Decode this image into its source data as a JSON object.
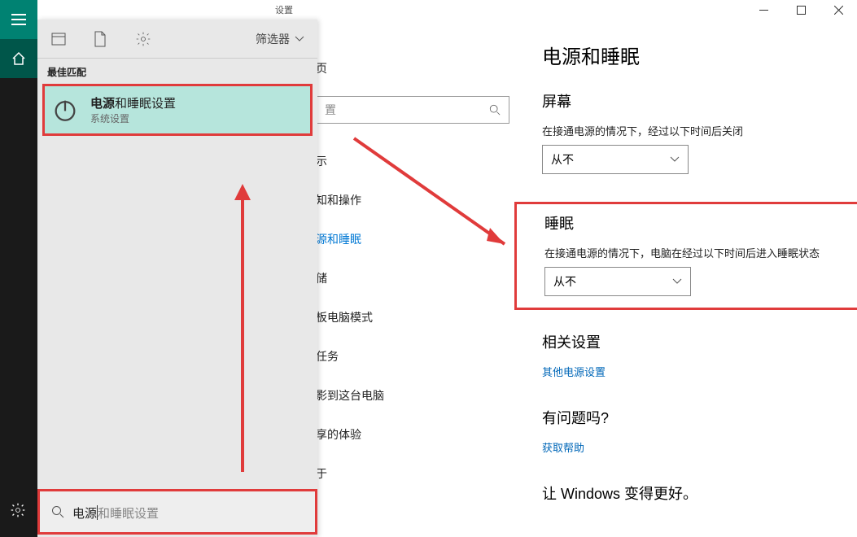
{
  "window": {
    "title": "设置"
  },
  "overlay": {
    "filter_label": "筛选器",
    "best_match": "最佳匹配",
    "result": {
      "prefix_bold": "电源",
      "rest": "和睡眠设置",
      "sub": "系统设置"
    },
    "search_typed": "电源",
    "search_placeholder_rest": "和睡眠设置"
  },
  "settings_page": {
    "home": "页",
    "search_placeholder": "置",
    "items": [
      "示",
      "知和操作",
      "源和睡眠",
      "储",
      "板电脑模式",
      "任务",
      "影到这台电脑",
      "享的体验",
      "于"
    ]
  },
  "main": {
    "title": "电源和睡眠",
    "screen": {
      "heading": "屏幕",
      "desc": "在接通电源的情况下，经过以下时间后关闭",
      "value": "从不"
    },
    "sleep": {
      "heading": "睡眠",
      "desc": "在接通电源的情况下，电脑在经过以下时间后进入睡眠状态",
      "value": "从不"
    },
    "related": {
      "heading": "相关设置",
      "link": "其他电源设置"
    },
    "help": {
      "heading": "有问题吗?",
      "link": "获取帮助"
    },
    "better": {
      "heading": "让 Windows 变得更好。"
    }
  }
}
